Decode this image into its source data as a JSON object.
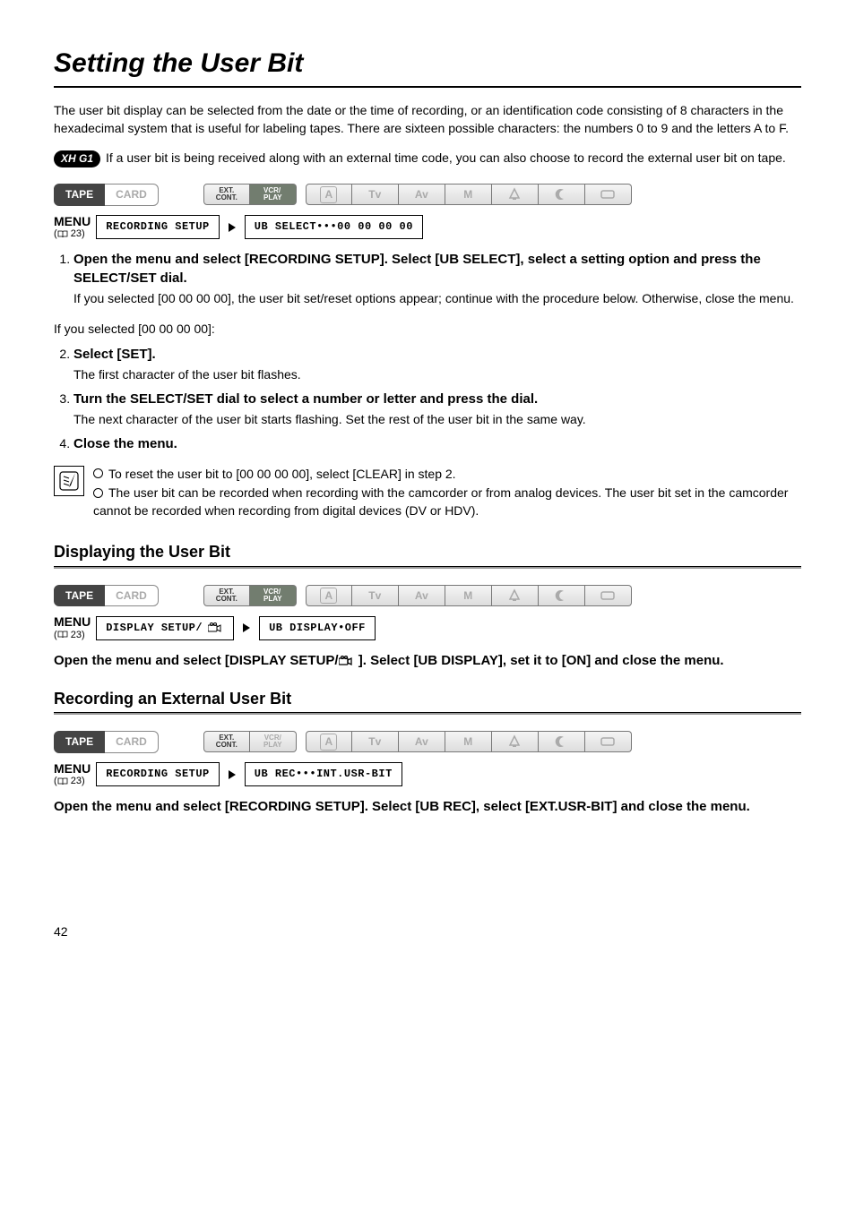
{
  "title": "Setting the User Bit",
  "intro": "The user bit display can be selected from the date or the time of recording, or an identification code consisting of 8 characters in the hexadecimal system that is useful for labeling tapes. There are sixteen possible characters: the numbers 0 to 9 and the letters A to F.",
  "xhg1_badge": "XH G1",
  "xhg1_text": "If a user bit is being received along with an external time code, you can also choose to record the external user bit on tape.",
  "tabs": {
    "tape": "TAPE",
    "card": "CARD"
  },
  "modes": {
    "ext1": "EXT.",
    "ext2": "CONT.",
    "vcr1": "VCR/",
    "vcr2": "PLAY",
    "a": "A",
    "tv": "Tv",
    "av": "Av",
    "m": "M"
  },
  "menu": {
    "label": "MENU",
    "ref_num": "23"
  },
  "box1": {
    "left": "RECORDING SETUP",
    "right": "UB SELECT•••00 00 00 00"
  },
  "steps_a": {
    "s1_title": "Open the menu and select [RECORDING SETUP]. Select [UB SELECT], select a setting option and press the SELECT/SET dial.",
    "s1_body": "If you selected [00 00 00 00], the user bit set/reset options appear; continue with the procedure below. Otherwise, close the menu."
  },
  "mid_text": "If you selected [00 00 00 00]:",
  "steps_b": {
    "s2_title": "Select [SET].",
    "s2_body": "The first character of the user bit flashes.",
    "s3_title": "Turn the SELECT/SET dial to select a number or letter and press the dial.",
    "s3_body": "The next character of the user bit starts flashing. Set the rest of the user bit in the same way.",
    "s4_title": "Close the menu."
  },
  "notes": {
    "n1": "To reset the user bit to [00 00 00 00], select [CLEAR] in step 2.",
    "n2": "The user bit can be recorded when recording with the camcorder or from analog devices. The user bit set in the camcorder cannot be recorded when recording from digital devices (DV or HDV)."
  },
  "sub1": "Displaying the User Bit",
  "box2": {
    "left": "DISPLAY SETUP/",
    "right": "UB DISPLAY•OFF"
  },
  "final1": "Open the menu and select [DISPLAY SETUP/      ]. Select [UB DISPLAY], set it to [ON] and close the menu.",
  "sub2": "Recording an External User Bit",
  "box3": {
    "left": "RECORDING SETUP",
    "right": "UB REC•••INT.USR-BIT"
  },
  "final2": "Open the menu and select [RECORDING SETUP]. Select [UB REC], select [EXT.USR-BIT] and close the menu.",
  "page": "42"
}
